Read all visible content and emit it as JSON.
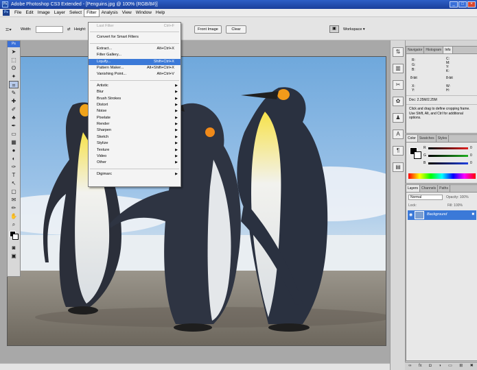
{
  "window": {
    "title": "Adobe Photoshop CS3 Extended - [Penguins.jpg @ 100% (RGB/8#)]",
    "app_icon": "photoshop-icon"
  },
  "menubar": {
    "items": [
      "File",
      "Edit",
      "Image",
      "Layer",
      "Select",
      "Filter",
      "Analysis",
      "View",
      "Window",
      "Help"
    ],
    "active": "Filter"
  },
  "options_bar": {
    "width_label": "Width:",
    "height_label": "Height:",
    "front_image_button": "Front Image",
    "clear_button": "Clear",
    "workspace_label": "Workspace ▾"
  },
  "filter_menu": {
    "items": [
      {
        "label": "Last Filter",
        "shortcut": "Ctrl+F",
        "disabled": true
      },
      {
        "separator": true
      },
      {
        "label": "Convert for Smart Filters"
      },
      {
        "separator": true
      },
      {
        "label": "Extract...",
        "shortcut": "Alt+Ctrl+X"
      },
      {
        "label": "Filter Gallery..."
      },
      {
        "label": "Liquify...",
        "shortcut": "Shift+Ctrl+X",
        "highlight": true
      },
      {
        "label": "Pattern Maker...",
        "shortcut": "Alt+Shift+Ctrl+X"
      },
      {
        "label": "Vanishing Point...",
        "shortcut": "Alt+Ctrl+V"
      },
      {
        "separator": true
      },
      {
        "label": "Artistic",
        "submenu": true
      },
      {
        "label": "Blur",
        "submenu": true
      },
      {
        "label": "Brush Strokes",
        "submenu": true
      },
      {
        "label": "Distort",
        "submenu": true
      },
      {
        "label": "Noise",
        "submenu": true
      },
      {
        "label": "Pixelate",
        "submenu": true
      },
      {
        "label": "Render",
        "submenu": true
      },
      {
        "label": "Sharpen",
        "submenu": true
      },
      {
        "label": "Sketch",
        "submenu": true
      },
      {
        "label": "Stylize",
        "submenu": true
      },
      {
        "label": "Texture",
        "submenu": true
      },
      {
        "label": "Video",
        "submenu": true
      },
      {
        "label": "Other",
        "submenu": true
      },
      {
        "separator": true
      },
      {
        "label": "Digimarc",
        "submenu": true
      }
    ]
  },
  "info_panel": {
    "tabs": [
      "Navigator",
      "Histogram",
      "Info"
    ],
    "active_tab": "Info",
    "cells": {
      "r": "R:",
      "g": "G:",
      "b": "B:",
      "c": "C:",
      "m": "M:",
      "y": "Y:",
      "k": "K:",
      "bit_left": "8-bit",
      "bit_right": "8-bit",
      "x": "X:",
      "y_coord": "Y:",
      "w": "W:",
      "h": "H:"
    },
    "doc_size": "Doc: 2.25M/2.25M",
    "hint": "Click and drag to define cropping frame. Use Shift, Alt, and Ctrl for additional options."
  },
  "color_panel": {
    "tabs": [
      "Color",
      "Swatches",
      "Styles"
    ],
    "active_tab": "Color",
    "sliders": [
      {
        "label": "R",
        "value": "0",
        "color": "#e02020"
      },
      {
        "label": "G",
        "value": "0",
        "color": "#20b020"
      },
      {
        "label": "B",
        "value": "0",
        "color": "#2040e0"
      }
    ]
  },
  "layers_panel": {
    "tabs": [
      "Layers",
      "Channels",
      "Paths"
    ],
    "active_tab": "Layers",
    "blend_mode": "Normal",
    "opacity_label": "Opacity: 100%",
    "lock_label": "Lock:",
    "fill_label": "Fill: 100%",
    "layers": [
      {
        "name": "Background",
        "visible": true,
        "locked": true
      }
    ]
  },
  "colors": {
    "accent": "#3b79d8",
    "titlebar": "#2e5fc7"
  }
}
